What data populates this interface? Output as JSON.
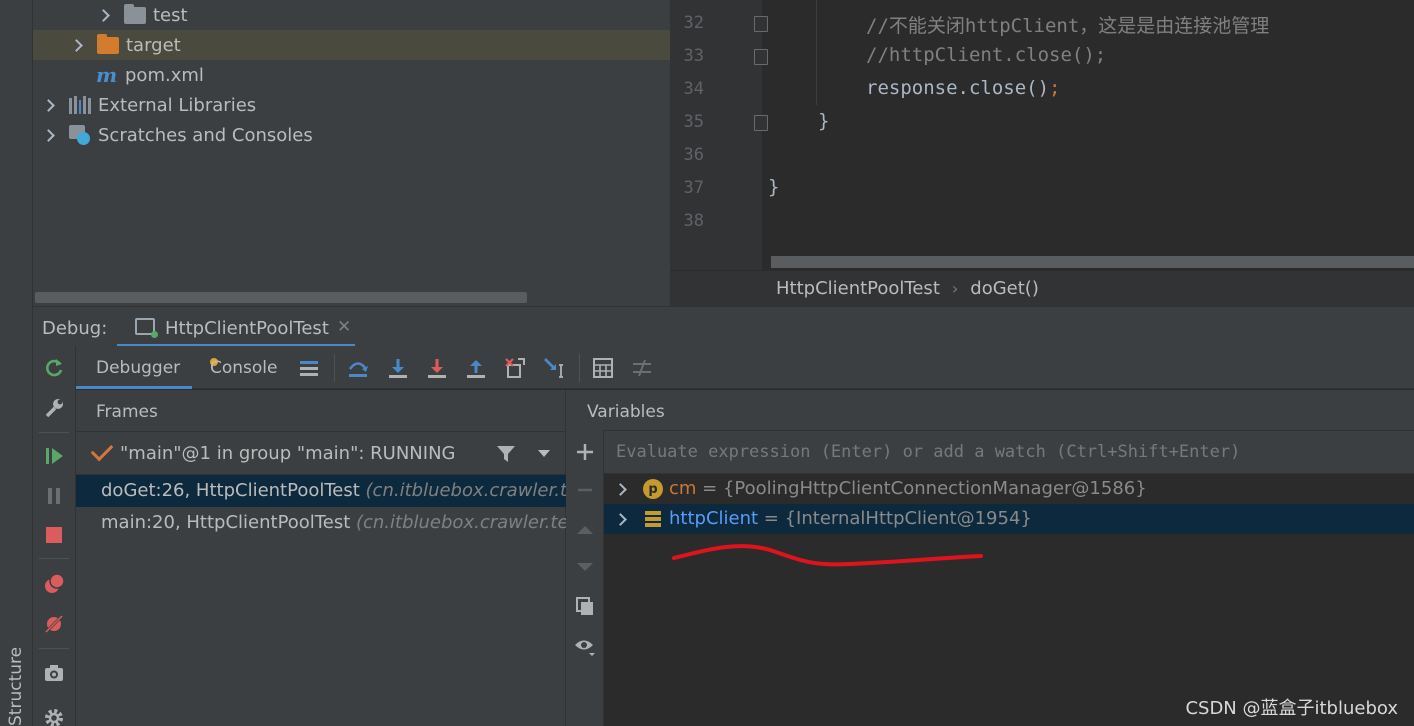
{
  "side": {
    "structure_label": "Structure"
  },
  "project_tree": {
    "items": [
      {
        "label": "test",
        "icon": "folder-icon",
        "expandable": true
      },
      {
        "label": "target",
        "icon": "folder-orange-icon",
        "expandable": true,
        "selected": true
      },
      {
        "label": "pom.xml",
        "icon": "maven-icon",
        "expandable": false
      },
      {
        "label": "External Libraries",
        "icon": "library-icon",
        "expandable": true
      },
      {
        "label": "Scratches and Consoles",
        "icon": "scratches-icon",
        "expandable": true
      }
    ]
  },
  "editor": {
    "lines": [
      {
        "num": "32",
        "text": "//不能关闭httpClient，这是是由连接池管理",
        "kind": "comment"
      },
      {
        "num": "33",
        "text": "//httpClient.close();",
        "kind": "comment"
      },
      {
        "num": "34",
        "text": "response.close()",
        "semi": ";",
        "kind": "plain"
      },
      {
        "num": "35",
        "text": "}",
        "kind": "plain"
      },
      {
        "num": "36",
        "text": "",
        "kind": "plain"
      },
      {
        "num": "37",
        "text": "}",
        "kind": "plain"
      },
      {
        "num": "38",
        "text": "",
        "kind": "plain"
      }
    ],
    "breadcrumb": {
      "class_name": "HttpClientPoolTest",
      "method_name": "doGet()"
    }
  },
  "debug": {
    "label": "Debug:",
    "session_tab": "HttpClientPoolTest",
    "tabs": {
      "debugger": "Debugger",
      "console": "Console"
    },
    "frames": {
      "title": "Frames",
      "thread": "\"main\"@1 in group \"main\": RUNNING",
      "rows": [
        {
          "method": "doGet:26, HttpClientPoolTest ",
          "package": "(cn.itbluebox.crawler.test)"
        },
        {
          "method": "main:20, HttpClientPoolTest ",
          "package": "(cn.itbluebox.crawler.test)"
        }
      ]
    },
    "variables": {
      "title": "Variables",
      "eval_placeholder": "Evaluate expression (Enter) or add a watch (Ctrl+Shift+Enter)",
      "rows": [
        {
          "name": "cm",
          "value": " = {PoolingHttpClientConnectionManager@1586}",
          "icon": "param-icon"
        },
        {
          "name": "httpClient",
          "value": " = {InternalHttpClient@1954}",
          "icon": "field-icon"
        }
      ]
    }
  },
  "colors": {
    "accent": "#4a88c7",
    "selection": "#0d293e",
    "annotation_red": "#e0131c",
    "keyword_orange": "#cc7832"
  },
  "watermark": "CSDN @蓝盒子itbluebox"
}
